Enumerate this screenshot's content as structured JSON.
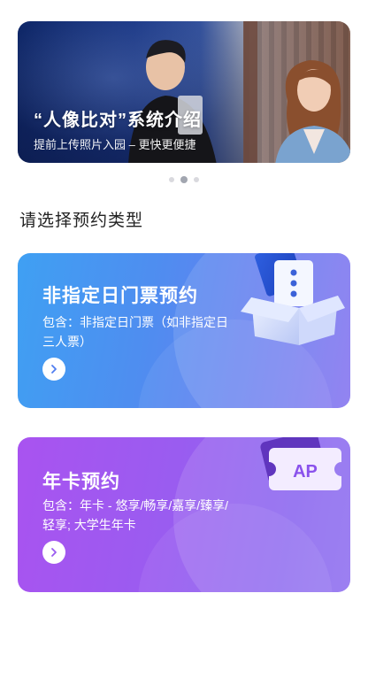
{
  "banner": {
    "title": "“人像比对”系统介绍",
    "subtitle": "提前上传照片入园 – 更快更便捷"
  },
  "carousel": {
    "count": 3,
    "active_index": 1
  },
  "section": {
    "title": "请选择预约类型"
  },
  "cards": [
    {
      "title": "非指定日门票预约",
      "description": "包含：非指定日门票（如非指定日三人票）",
      "icon": "ticket-box-icon",
      "color_start": "#3fa0f3",
      "color_end": "#8473ef"
    },
    {
      "title": "年卡预约",
      "description": "包含：年卡 - 悠享/畅享/嘉享/臻享/轻享; 大学生年卡",
      "icon": "ap-ticket-icon",
      "badge": "AP",
      "color_start": "#a953f0",
      "color_end": "#8f6ff0"
    }
  ]
}
